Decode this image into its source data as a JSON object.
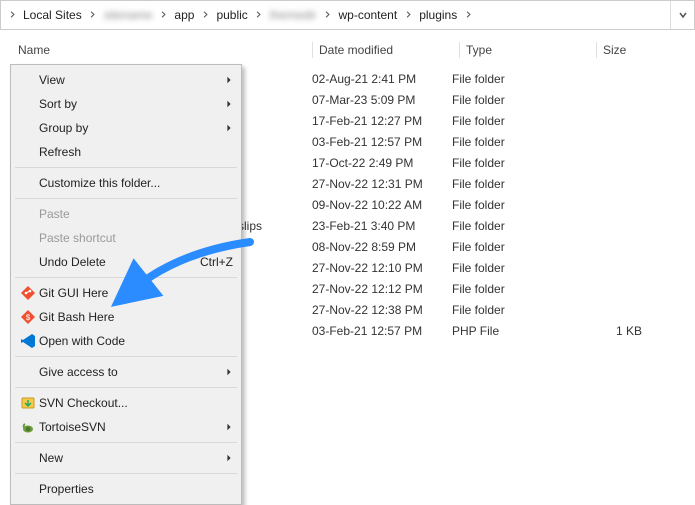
{
  "breadcrumb": {
    "items": [
      {
        "label": "Local Sites",
        "blur": false
      },
      {
        "label": "sitename",
        "blur": true
      },
      {
        "label": "app",
        "blur": false
      },
      {
        "label": "public",
        "blur": false
      },
      {
        "label": "themedir",
        "blur": true
      },
      {
        "label": "wp-content",
        "blur": false
      },
      {
        "label": "plugins",
        "blur": false
      }
    ]
  },
  "columns": {
    "name": "Name",
    "date": "Date modified",
    "type": "Type",
    "size": "Size"
  },
  "files": [
    {
      "date": "02-Aug-21 2:41 PM",
      "type": "File folder",
      "size": ""
    },
    {
      "date": "07-Mar-23 5:09 PM",
      "type": "File folder",
      "size": ""
    },
    {
      "date": "17-Feb-21 12:27 PM",
      "type": "File folder",
      "size": ""
    },
    {
      "date": "03-Feb-21 12:57 PM",
      "type": "File folder",
      "size": ""
    },
    {
      "date": "17-Oct-22 2:49 PM",
      "type": "File folder",
      "size": ""
    },
    {
      "date": "27-Nov-22 12:31 PM",
      "type": "File folder",
      "size": ""
    },
    {
      "date": "09-Nov-22 10:22 AM",
      "type": "File folder",
      "size": ""
    },
    {
      "date": "23-Feb-21 3:40 PM",
      "type": "File folder",
      "size": "",
      "peek": "slips"
    },
    {
      "date": "08-Nov-22 8:59 PM",
      "type": "File folder",
      "size": ""
    },
    {
      "date": "27-Nov-22 12:10 PM",
      "type": "File folder",
      "size": ""
    },
    {
      "date": "27-Nov-22 12:12 PM",
      "type": "File folder",
      "size": ""
    },
    {
      "date": "27-Nov-22 12:38 PM",
      "type": "File folder",
      "size": ""
    },
    {
      "date": "03-Feb-21 12:57 PM",
      "type": "PHP File",
      "size": "1 KB"
    }
  ],
  "context_menu": {
    "groups": [
      [
        {
          "label": "View",
          "submenu": true
        },
        {
          "label": "Sort by",
          "submenu": true
        },
        {
          "label": "Group by",
          "submenu": true
        },
        {
          "label": "Refresh"
        }
      ],
      [
        {
          "label": "Customize this folder..."
        }
      ],
      [
        {
          "label": "Paste",
          "disabled": true
        },
        {
          "label": "Paste shortcut",
          "disabled": true
        },
        {
          "label": "Undo Delete",
          "shortcut": "Ctrl+Z"
        }
      ],
      [
        {
          "icon": "git-gui",
          "label": "Git GUI Here"
        },
        {
          "icon": "git-bash",
          "label": "Git Bash Here"
        },
        {
          "icon": "vscode",
          "label": "Open with Code"
        }
      ],
      [
        {
          "label": "Give access to",
          "submenu": true
        }
      ],
      [
        {
          "icon": "svn-checkout",
          "label": "SVN Checkout..."
        },
        {
          "icon": "tortoise",
          "label": "TortoiseSVN",
          "submenu": true
        }
      ],
      [
        {
          "label": "New",
          "submenu": true
        }
      ],
      [
        {
          "label": "Properties"
        }
      ]
    ]
  },
  "arrow_color": "#2a8cff"
}
